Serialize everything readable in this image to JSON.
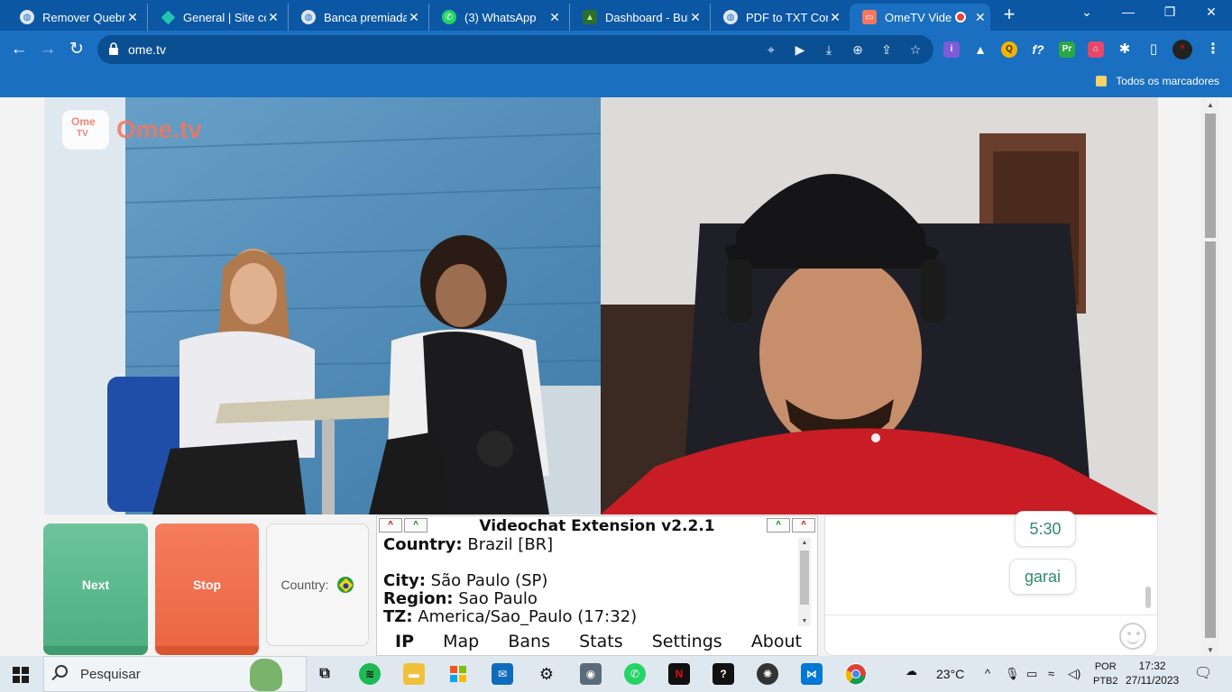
{
  "browser": {
    "tabs": [
      {
        "title": "Remover Quebra",
        "favicon": "globe-icon",
        "active": false
      },
      {
        "title": "General | Site co",
        "favicon": "diamond-icon",
        "active": false
      },
      {
        "title": "Banca premiada",
        "favicon": "globe-icon",
        "active": false
      },
      {
        "title": "(3) WhatsApp",
        "favicon": "whatsapp-icon",
        "active": false
      },
      {
        "title": "Dashboard - Bul",
        "favicon": "dashboard-icon",
        "active": false
      },
      {
        "title": "PDF to TXT Conv",
        "favicon": "globe-icon",
        "active": false
      },
      {
        "title": "OmeTV Vide",
        "favicon": "ometv-icon",
        "active": true
      }
    ],
    "new_tab": "+",
    "url": "ome.tv",
    "bookmark_folder": "Todos os marcadores",
    "accent": "#1a6fc1"
  },
  "page": {
    "logo": {
      "tv_top": "Ome",
      "tv_bottom": "TV",
      "word": "Ome.tv"
    },
    "buttons": {
      "next": "Next",
      "stop": "Stop",
      "country_label": "Country:"
    },
    "extension": {
      "title": "Videochat Extension v2.2.1",
      "up_arrow": "^",
      "lines": [
        {
          "key": "Country:",
          "value": " Brazil [BR]"
        },
        {
          "key": "",
          "value": ""
        },
        {
          "key": "City:",
          "value": " São Paulo (SP)"
        },
        {
          "key": "Region:",
          "value": " Sao Paulo"
        },
        {
          "key": "TZ:",
          "value": " America/Sao_Paulo (17:32)"
        }
      ],
      "tabs": [
        "IP",
        "Map",
        "Bans",
        "Stats",
        "Settings",
        "About"
      ],
      "selected_tab": "IP"
    },
    "chat": {
      "messages": [
        "5:30",
        "garai"
      ]
    }
  },
  "taskbar": {
    "search_placeholder": "Pesquisar",
    "weather": "23°C",
    "lang_top": "POR",
    "lang_bottom": "PTB2",
    "time": "17:32",
    "date": "27/11/2023"
  }
}
